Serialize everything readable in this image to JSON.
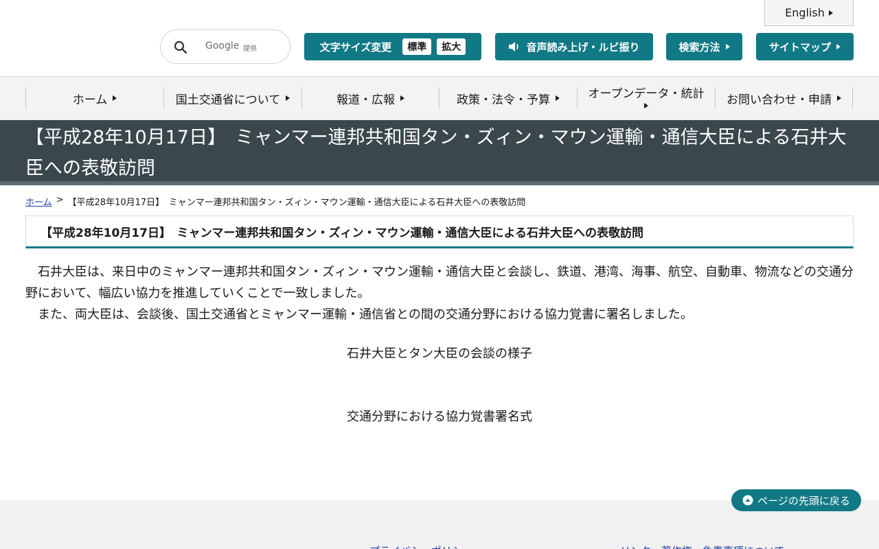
{
  "header": {
    "english_label": "English",
    "search": {
      "provider": "Google",
      "provided_by": "提供"
    },
    "font_size": {
      "label": "文字サイズ変更",
      "standard": "標準",
      "large": "拡大"
    },
    "speech_label": "音声読み上げ・ルビ振り",
    "search_method_label": "検索方法",
    "sitemap_label": "サイトマップ",
    "accent_color": "#107985"
  },
  "nav": {
    "items": [
      {
        "label": "ホーム"
      },
      {
        "label": "国土交通省について"
      },
      {
        "label": "報道・広報"
      },
      {
        "label": "政策・法令・予算"
      },
      {
        "label": "オープンデータ・統計"
      },
      {
        "label": "お問い合わせ・申請"
      }
    ]
  },
  "page": {
    "title": "【平成28年10月17日】　ミャンマー連邦共和国タン・ズィン・マウン運輸・通信大臣による石井大臣への表敬訪問",
    "breadcrumb": {
      "home": "ホーム",
      "separator": ">",
      "current": "【平成28年10月17日】　ミャンマー連邦共和国タン・ズィン・マウン運輸・通信大臣による石井大臣への表敬訪問"
    },
    "heading": "【平成28年10月17日】　ミャンマー連邦共和国タン・ズィン・マウン運輸・通信大臣による石井大臣への表敬訪問",
    "paragraph1": "石井大臣は、来日中のミャンマー連邦共和国タン・ズィン・マウン運輸・通信大臣と会談し、鉄道、港湾、海事、航空、自動車、物流などの交通分野において、幅広い協力を推進していくことで一致しました。",
    "paragraph2": "また、両大臣は、会談後、国土交通省とミャンマー運輸・通信省との間の交通分野における協力覚書に署名しました。",
    "caption1": "石井大臣とタン大臣の会談の様子",
    "caption2": "交通分野における協力覚書署名式"
  },
  "page_top_label": "ページの先頭に戻る",
  "footer": {
    "links": [
      "プライバシーポリシー",
      "リンク・著作権・免責事項について"
    ]
  }
}
